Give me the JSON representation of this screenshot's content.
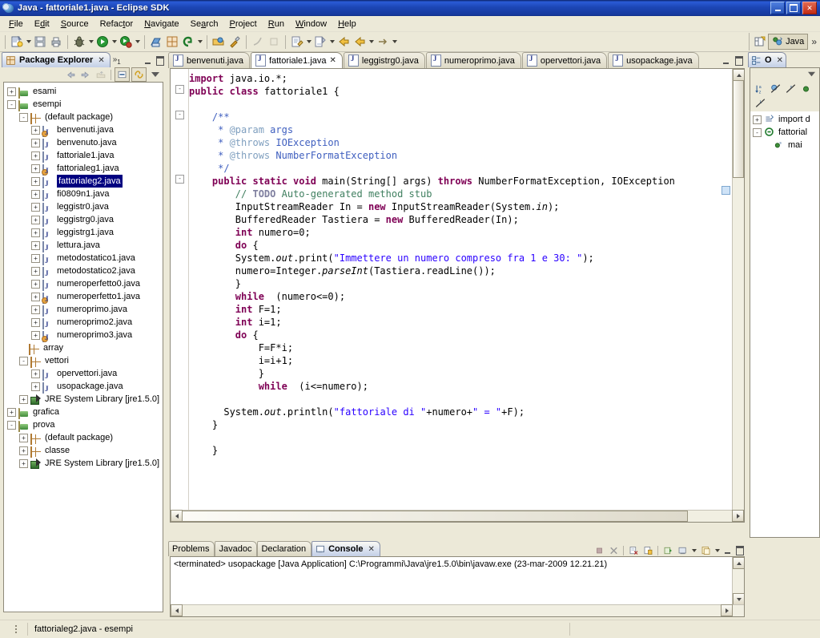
{
  "window": {
    "title": "Java - fattoriale1.java - Eclipse SDK",
    "icon": "eclipse-icon",
    "minimize": "minimize-button",
    "maximize": "maximize-button",
    "close": "close-button",
    "close_glyph": "✕"
  },
  "menubar": {
    "items": [
      {
        "label": "File",
        "mnemonic": "F"
      },
      {
        "label": "Edit",
        "mnemonic": "E"
      },
      {
        "label": "Source",
        "mnemonic": "S"
      },
      {
        "label": "Refactor",
        "mnemonic": "t"
      },
      {
        "label": "Navigate",
        "mnemonic": "N"
      },
      {
        "label": "Search",
        "mnemonic": "a"
      },
      {
        "label": "Project",
        "mnemonic": "P"
      },
      {
        "label": "Run",
        "mnemonic": "R"
      },
      {
        "label": "Window",
        "mnemonic": "W"
      },
      {
        "label": "Help",
        "mnemonic": "H"
      }
    ]
  },
  "toolbar": {
    "groups": [
      [
        "new-wizard-icon",
        "dropdown",
        "save-icon",
        "print-icon"
      ],
      [
        "debug-icon",
        "dropdown",
        "run-icon",
        "dropdown",
        "external-tools-icon",
        "dropdown"
      ],
      [
        "new-java-package-icon",
        "new-java-class-icon",
        "search-icon",
        "dropdown"
      ],
      [
        "open-type-icon",
        "build-all-icon"
      ],
      [
        "previous-annotation-icon",
        "next-annotation-icon"
      ],
      [
        "last-edit-location-icon",
        "dropdown",
        "next-edit-icon",
        "dropdown",
        "back-icon",
        "forward-icon",
        "dropdown",
        "forward-arrow-icon",
        "dropdown"
      ]
    ],
    "perspective": {
      "open_perspective": "open-perspective-icon",
      "active_label": "Java",
      "overflow": "»"
    }
  },
  "package_explorer": {
    "tab_label": "Package Explorer",
    "tab_icon": "package-explorer-icon",
    "tab_close": "✕",
    "overflow_label": "»",
    "overflow_count": "1",
    "toolbar": [
      "back-icon",
      "forward-icon",
      "up-icon",
      "collapse-all-icon",
      "link-with-editor-icon",
      "view-menu-icon"
    ],
    "tree": [
      {
        "indent": 0,
        "expander": "+",
        "icon": "project-icon",
        "label": "esami",
        "selected": false
      },
      {
        "indent": 0,
        "expander": "-",
        "icon": "project-icon",
        "label": "esempi",
        "selected": false
      },
      {
        "indent": 1,
        "expander": "-",
        "icon": "package-icon",
        "label": "(default package)",
        "selected": false
      },
      {
        "indent": 2,
        "expander": "+",
        "icon": "java-file-warning-icon",
        "label": "benvenuti.java",
        "selected": false
      },
      {
        "indent": 2,
        "expander": "+",
        "icon": "java-file-icon",
        "label": "benvenuto.java",
        "selected": false
      },
      {
        "indent": 2,
        "expander": "+",
        "icon": "java-file-icon",
        "label": "fattoriale1.java",
        "selected": false
      },
      {
        "indent": 2,
        "expander": "+",
        "icon": "java-file-warning-icon",
        "label": "fattorialeg1.java",
        "selected": false
      },
      {
        "indent": 2,
        "expander": "+",
        "icon": "java-file-icon",
        "label": "fattorialeg2.java",
        "selected": true
      },
      {
        "indent": 2,
        "expander": "+",
        "icon": "java-file-icon",
        "label": "fi0809n1.java",
        "selected": false
      },
      {
        "indent": 2,
        "expander": "+",
        "icon": "java-file-icon",
        "label": "leggistr0.java",
        "selected": false
      },
      {
        "indent": 2,
        "expander": "+",
        "icon": "java-file-icon",
        "label": "leggistrg0.java",
        "selected": false
      },
      {
        "indent": 2,
        "expander": "+",
        "icon": "java-file-icon",
        "label": "leggistrg1.java",
        "selected": false
      },
      {
        "indent": 2,
        "expander": "+",
        "icon": "java-file-icon",
        "label": "lettura.java",
        "selected": false
      },
      {
        "indent": 2,
        "expander": "+",
        "icon": "java-file-icon",
        "label": "metodostatico1.java",
        "selected": false
      },
      {
        "indent": 2,
        "expander": "+",
        "icon": "java-file-icon",
        "label": "metodostatico2.java",
        "selected": false
      },
      {
        "indent": 2,
        "expander": "+",
        "icon": "java-file-icon",
        "label": "numeroperfetto0.java",
        "selected": false
      },
      {
        "indent": 2,
        "expander": "+",
        "icon": "java-file-warning-icon",
        "label": "numeroperfetto1.java",
        "selected": false
      },
      {
        "indent": 2,
        "expander": "+",
        "icon": "java-file-icon",
        "label": "numeroprimo.java",
        "selected": false
      },
      {
        "indent": 2,
        "expander": "+",
        "icon": "java-file-icon",
        "label": "numeroprimo2.java",
        "selected": false
      },
      {
        "indent": 2,
        "expander": "+",
        "icon": "java-file-warning-icon",
        "label": "numeroprimo3.java",
        "selected": false
      },
      {
        "indent": 1,
        "expander": "",
        "icon": "package-empty-icon",
        "label": "array",
        "selected": false
      },
      {
        "indent": 1,
        "expander": "-",
        "icon": "package-icon",
        "label": "vettori",
        "selected": false
      },
      {
        "indent": 2,
        "expander": "+",
        "icon": "java-file-icon",
        "label": "opervettori.java",
        "selected": false
      },
      {
        "indent": 2,
        "expander": "+",
        "icon": "java-file-icon",
        "label": "usopackage.java",
        "selected": false
      },
      {
        "indent": 1,
        "expander": "+",
        "icon": "jre-library-icon",
        "label": "JRE System Library [jre1.5.0]",
        "selected": false
      },
      {
        "indent": 0,
        "expander": "+",
        "icon": "project-icon",
        "label": "grafica",
        "selected": false
      },
      {
        "indent": 0,
        "expander": "-",
        "icon": "project-icon",
        "label": "prova",
        "selected": false
      },
      {
        "indent": 1,
        "expander": "+",
        "icon": "package-empty-icon",
        "label": "(default package)",
        "selected": false
      },
      {
        "indent": 1,
        "expander": "+",
        "icon": "package-icon",
        "label": "classe",
        "selected": false
      },
      {
        "indent": 1,
        "expander": "+",
        "icon": "jre-library-icon",
        "label": "JRE System Library [jre1.5.0]",
        "selected": false
      }
    ]
  },
  "editor": {
    "tabs": [
      {
        "label": "benvenuti.java",
        "active": false,
        "closable": false
      },
      {
        "label": "fattoriale1.java",
        "active": true,
        "closable": true,
        "close_glyph": "✕"
      },
      {
        "label": "leggistrg0.java",
        "active": false,
        "closable": false
      },
      {
        "label": "numeroprimo.java",
        "active": false,
        "closable": false
      },
      {
        "label": "opervettori.java",
        "active": false,
        "closable": false
      },
      {
        "label": "usopackage.java",
        "active": false,
        "closable": false
      }
    ],
    "code_lines": [
      [
        {
          "t": "import",
          "c": "kw"
        },
        {
          "t": " java.io.*;",
          "c": ""
        }
      ],
      [
        {
          "t": "public class",
          "c": "kw"
        },
        {
          "t": " fattoriale1 {",
          "c": ""
        }
      ],
      [],
      [
        {
          "t": "    /**",
          "c": "jdoc"
        }
      ],
      [
        {
          "t": "     * ",
          "c": "jdoc"
        },
        {
          "t": "@param",
          "c": "jdoctag"
        },
        {
          "t": " args",
          "c": "jdoc"
        }
      ],
      [
        {
          "t": "     * ",
          "c": "jdoc"
        },
        {
          "t": "@throws",
          "c": "jdoctag"
        },
        {
          "t": " IOException",
          "c": "jdoc"
        }
      ],
      [
        {
          "t": "     * ",
          "c": "jdoc"
        },
        {
          "t": "@throws",
          "c": "jdoctag"
        },
        {
          "t": " NumberFormatException",
          "c": "jdoc"
        }
      ],
      [
        {
          "t": "     */",
          "c": "jdoc"
        }
      ],
      [
        {
          "t": "    ",
          "c": ""
        },
        {
          "t": "public static void",
          "c": "kw"
        },
        {
          "t": " main(String[] args) ",
          "c": ""
        },
        {
          "t": "throws",
          "c": "kw"
        },
        {
          "t": " NumberFormatException, IOException",
          "c": ""
        }
      ],
      [
        {
          "t": "        ",
          "c": ""
        },
        {
          "t": "// ",
          "c": "cmt"
        },
        {
          "t": "TODO",
          "c": "todo"
        },
        {
          "t": " Auto-generated method stub",
          "c": "cmt"
        }
      ],
      [
        {
          "t": "        InputStreamReader In = ",
          "c": ""
        },
        {
          "t": "new",
          "c": "kw"
        },
        {
          "t": " InputStreamReader(System.",
          "c": ""
        },
        {
          "t": "in",
          "c": "stat"
        },
        {
          "t": ");",
          "c": ""
        }
      ],
      [
        {
          "t": "        BufferedReader Tastiera = ",
          "c": ""
        },
        {
          "t": "new",
          "c": "kw"
        },
        {
          "t": " BufferedReader(In);",
          "c": ""
        }
      ],
      [
        {
          "t": "        ",
          "c": ""
        },
        {
          "t": "int",
          "c": "kw"
        },
        {
          "t": " numero=0;",
          "c": ""
        }
      ],
      [
        {
          "t": "        ",
          "c": ""
        },
        {
          "t": "do",
          "c": "kw"
        },
        {
          "t": " {",
          "c": ""
        }
      ],
      [
        {
          "t": "        System.",
          "c": ""
        },
        {
          "t": "out",
          "c": "stat"
        },
        {
          "t": ".print(",
          "c": ""
        },
        {
          "t": "\"Immettere un numero compreso fra 1 e 30: \"",
          "c": "str"
        },
        {
          "t": ");",
          "c": ""
        }
      ],
      [
        {
          "t": "        numero=Integer.",
          "c": ""
        },
        {
          "t": "parseInt",
          "c": "stat"
        },
        {
          "t": "(Tastiera.readLine());",
          "c": ""
        }
      ],
      [
        {
          "t": "        }",
          "c": ""
        }
      ],
      [
        {
          "t": "        ",
          "c": ""
        },
        {
          "t": "while",
          "c": "kw"
        },
        {
          "t": "  (numero<=0);",
          "c": ""
        }
      ],
      [
        {
          "t": "        ",
          "c": ""
        },
        {
          "t": "int",
          "c": "kw"
        },
        {
          "t": " F=1;",
          "c": ""
        }
      ],
      [
        {
          "t": "        ",
          "c": ""
        },
        {
          "t": "int",
          "c": "kw"
        },
        {
          "t": " i=1;",
          "c": ""
        }
      ],
      [
        {
          "t": "        ",
          "c": ""
        },
        {
          "t": "do",
          "c": "kw"
        },
        {
          "t": " {",
          "c": ""
        }
      ],
      [
        {
          "t": "            F=F*i;",
          "c": ""
        }
      ],
      [
        {
          "t": "            i=i+1;",
          "c": ""
        }
      ],
      [
        {
          "t": "            }",
          "c": ""
        }
      ],
      [
        {
          "t": "            ",
          "c": ""
        },
        {
          "t": "while",
          "c": "kw"
        },
        {
          "t": "  (i<=numero);",
          "c": ""
        }
      ],
      [],
      [
        {
          "t": "      System.",
          "c": ""
        },
        {
          "t": "out",
          "c": "stat"
        },
        {
          "t": ".println(",
          "c": ""
        },
        {
          "t": "\"fattoriale di \"",
          "c": "str"
        },
        {
          "t": "+numero+",
          "c": ""
        },
        {
          "t": "\" = \"",
          "c": "str"
        },
        {
          "t": "+F);",
          "c": ""
        }
      ],
      [
        {
          "t": "    }",
          "c": ""
        }
      ],
      [],
      [
        {
          "t": "    }",
          "c": ""
        }
      ]
    ],
    "folding_markers": [
      {
        "line": 1,
        "glyph": "-"
      },
      {
        "line": 3,
        "glyph": "-"
      },
      {
        "line": 8,
        "glyph": "-"
      }
    ]
  },
  "outline": {
    "tab_label": "O",
    "tab_close": "✕",
    "tab_icon": "outline-icon",
    "toolbar": [
      "sort-icon",
      "hide-fields-icon",
      "hide-static-icon",
      "hide-nonpublic-icon",
      "hide-local-types-icon"
    ],
    "menu_icon": "view-menu-icon",
    "tree": [
      {
        "indent": 0,
        "expander": "+",
        "icon": "import-container-icon",
        "label": "import d"
      },
      {
        "indent": 0,
        "expander": "-",
        "icon": "class-icon",
        "label": "fattorial"
      },
      {
        "indent": 1,
        "expander": "",
        "icon": "method-public-static-icon",
        "label": "mai"
      }
    ]
  },
  "console": {
    "tabs": [
      {
        "label": "Problems",
        "active": false,
        "icon": "",
        "closable": false
      },
      {
        "label": "Javadoc",
        "active": false,
        "icon": "",
        "closable": false
      },
      {
        "label": "Declaration",
        "active": false,
        "icon": "",
        "closable": false
      },
      {
        "label": "Console",
        "active": true,
        "icon": "console-icon",
        "closable": true,
        "close_glyph": "✕"
      }
    ],
    "toolbar": [
      "terminate-icon",
      "remove-launch-icon",
      "remove-all-icon",
      "clear-console-icon",
      "scroll-lock-icon",
      "pin-console-icon",
      "display-selected-console-icon",
      "open-console-icon"
    ],
    "output": "<terminated> usopackage [Java Application] C:\\Programmi\\Java\\jre1.5.0\\bin\\javaw.exe (23-mar-2009 12.21.21)"
  },
  "statusbar": {
    "text": "fattorialeg2.java - esempi"
  },
  "colors": {
    "titlebar_blue": "#0a246a",
    "chrome": "#ece9d8",
    "keyword": "#7f0055",
    "string": "#2a00ff",
    "comment": "#3f7f5f",
    "javadoc": "#3f5fbf",
    "selection": "#000080",
    "editor_bg": "#ffffff"
  }
}
